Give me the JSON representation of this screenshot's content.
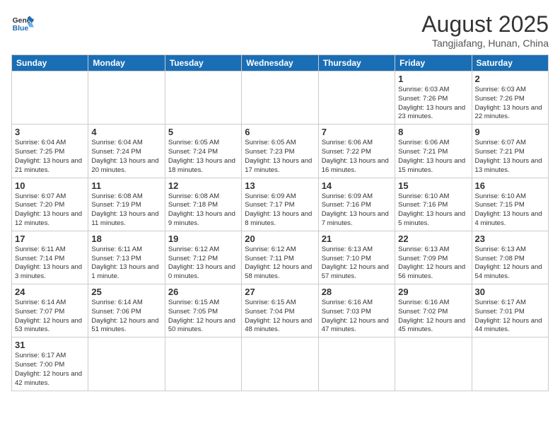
{
  "logo": {
    "text_general": "General",
    "text_blue": "Blue"
  },
  "header": {
    "month_year": "August 2025",
    "location": "Tangjiafang, Hunan, China"
  },
  "weekdays": [
    "Sunday",
    "Monday",
    "Tuesday",
    "Wednesday",
    "Thursday",
    "Friday",
    "Saturday"
  ],
  "weeks": [
    [
      {
        "day": "",
        "info": ""
      },
      {
        "day": "",
        "info": ""
      },
      {
        "day": "",
        "info": ""
      },
      {
        "day": "",
        "info": ""
      },
      {
        "day": "",
        "info": ""
      },
      {
        "day": "1",
        "info": "Sunrise: 6:03 AM\nSunset: 7:26 PM\nDaylight: 13 hours and 23 minutes."
      },
      {
        "day": "2",
        "info": "Sunrise: 6:03 AM\nSunset: 7:26 PM\nDaylight: 13 hours and 22 minutes."
      }
    ],
    [
      {
        "day": "3",
        "info": "Sunrise: 6:04 AM\nSunset: 7:25 PM\nDaylight: 13 hours and 21 minutes."
      },
      {
        "day": "4",
        "info": "Sunrise: 6:04 AM\nSunset: 7:24 PM\nDaylight: 13 hours and 20 minutes."
      },
      {
        "day": "5",
        "info": "Sunrise: 6:05 AM\nSunset: 7:24 PM\nDaylight: 13 hours and 18 minutes."
      },
      {
        "day": "6",
        "info": "Sunrise: 6:05 AM\nSunset: 7:23 PM\nDaylight: 13 hours and 17 minutes."
      },
      {
        "day": "7",
        "info": "Sunrise: 6:06 AM\nSunset: 7:22 PM\nDaylight: 13 hours and 16 minutes."
      },
      {
        "day": "8",
        "info": "Sunrise: 6:06 AM\nSunset: 7:21 PM\nDaylight: 13 hours and 15 minutes."
      },
      {
        "day": "9",
        "info": "Sunrise: 6:07 AM\nSunset: 7:21 PM\nDaylight: 13 hours and 13 minutes."
      }
    ],
    [
      {
        "day": "10",
        "info": "Sunrise: 6:07 AM\nSunset: 7:20 PM\nDaylight: 13 hours and 12 minutes."
      },
      {
        "day": "11",
        "info": "Sunrise: 6:08 AM\nSunset: 7:19 PM\nDaylight: 13 hours and 11 minutes."
      },
      {
        "day": "12",
        "info": "Sunrise: 6:08 AM\nSunset: 7:18 PM\nDaylight: 13 hours and 9 minutes."
      },
      {
        "day": "13",
        "info": "Sunrise: 6:09 AM\nSunset: 7:17 PM\nDaylight: 13 hours and 8 minutes."
      },
      {
        "day": "14",
        "info": "Sunrise: 6:09 AM\nSunset: 7:16 PM\nDaylight: 13 hours and 7 minutes."
      },
      {
        "day": "15",
        "info": "Sunrise: 6:10 AM\nSunset: 7:16 PM\nDaylight: 13 hours and 5 minutes."
      },
      {
        "day": "16",
        "info": "Sunrise: 6:10 AM\nSunset: 7:15 PM\nDaylight: 13 hours and 4 minutes."
      }
    ],
    [
      {
        "day": "17",
        "info": "Sunrise: 6:11 AM\nSunset: 7:14 PM\nDaylight: 13 hours and 3 minutes."
      },
      {
        "day": "18",
        "info": "Sunrise: 6:11 AM\nSunset: 7:13 PM\nDaylight: 13 hours and 1 minute."
      },
      {
        "day": "19",
        "info": "Sunrise: 6:12 AM\nSunset: 7:12 PM\nDaylight: 13 hours and 0 minutes."
      },
      {
        "day": "20",
        "info": "Sunrise: 6:12 AM\nSunset: 7:11 PM\nDaylight: 12 hours and 58 minutes."
      },
      {
        "day": "21",
        "info": "Sunrise: 6:13 AM\nSunset: 7:10 PM\nDaylight: 12 hours and 57 minutes."
      },
      {
        "day": "22",
        "info": "Sunrise: 6:13 AM\nSunset: 7:09 PM\nDaylight: 12 hours and 56 minutes."
      },
      {
        "day": "23",
        "info": "Sunrise: 6:13 AM\nSunset: 7:08 PM\nDaylight: 12 hours and 54 minutes."
      }
    ],
    [
      {
        "day": "24",
        "info": "Sunrise: 6:14 AM\nSunset: 7:07 PM\nDaylight: 12 hours and 53 minutes."
      },
      {
        "day": "25",
        "info": "Sunrise: 6:14 AM\nSunset: 7:06 PM\nDaylight: 12 hours and 51 minutes."
      },
      {
        "day": "26",
        "info": "Sunrise: 6:15 AM\nSunset: 7:05 PM\nDaylight: 12 hours and 50 minutes."
      },
      {
        "day": "27",
        "info": "Sunrise: 6:15 AM\nSunset: 7:04 PM\nDaylight: 12 hours and 48 minutes."
      },
      {
        "day": "28",
        "info": "Sunrise: 6:16 AM\nSunset: 7:03 PM\nDaylight: 12 hours and 47 minutes."
      },
      {
        "day": "29",
        "info": "Sunrise: 6:16 AM\nSunset: 7:02 PM\nDaylight: 12 hours and 45 minutes."
      },
      {
        "day": "30",
        "info": "Sunrise: 6:17 AM\nSunset: 7:01 PM\nDaylight: 12 hours and 44 minutes."
      }
    ],
    [
      {
        "day": "31",
        "info": "Sunrise: 6:17 AM\nSunset: 7:00 PM\nDaylight: 12 hours and 42 minutes."
      },
      {
        "day": "",
        "info": ""
      },
      {
        "day": "",
        "info": ""
      },
      {
        "day": "",
        "info": ""
      },
      {
        "day": "",
        "info": ""
      },
      {
        "day": "",
        "info": ""
      },
      {
        "day": "",
        "info": ""
      }
    ]
  ]
}
